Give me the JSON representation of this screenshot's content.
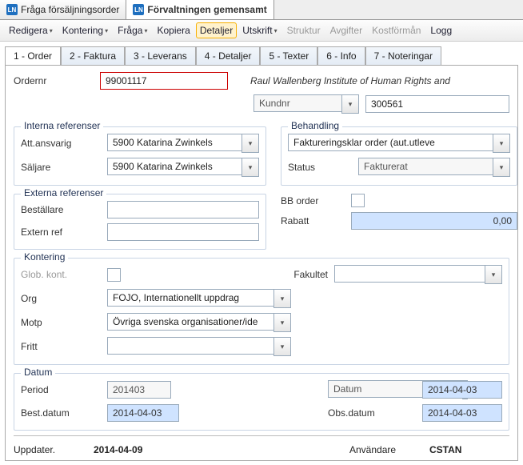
{
  "top_tabs": {
    "t1": "Fråga försäljningsorder",
    "t2": "Förvaltningen gemensamt",
    "ico": "LN"
  },
  "menu": {
    "redigera": "Redigera",
    "kontering": "Kontering",
    "fraga": "Fråga",
    "kopiera": "Kopiera",
    "detaljer": "Detaljer",
    "utskrift": "Utskrift",
    "struktur": "Struktur",
    "avgifter": "Avgifter",
    "kostforman": "Kostförmån",
    "logg": "Logg"
  },
  "sub_tabs": {
    "order": "1 - Order",
    "faktura": "2 - Faktura",
    "leverans": "3 - Leverans",
    "detaljer": "4 - Detaljer",
    "texter": "5 - Texter",
    "info": "6 - Info",
    "noteringar": "7 - Noteringar"
  },
  "order": {
    "ordernr_label": "Ordernr",
    "ordernr": "99001117",
    "customer_name": "Raul Wallenberg Institute of Human Rights and",
    "kundnr_label": "Kundnr",
    "kundnr": "300561"
  },
  "interna": {
    "legend": "Interna referenser",
    "att_label": "Att.ansvarig",
    "att_val": "5900 Katarina Zwinkels",
    "saljare_label": "Säljare",
    "saljare_val": "5900 Katarina Zwinkels"
  },
  "behandling": {
    "legend": "Behandling",
    "val": "Faktureringsklar order (aut.utleve",
    "status_label": "Status",
    "status_val": "Fakturerat",
    "bb_label": "BB order",
    "rabatt_label": "Rabatt",
    "rabatt_val": "0,00"
  },
  "externa": {
    "legend": "Externa referenser",
    "bestallare_label": "Beställare",
    "extern_label": "Extern ref"
  },
  "kontering": {
    "legend": "Kontering",
    "glob_label": "Glob. kont.",
    "fakultet_label": "Fakultet",
    "org_label": "Org",
    "org_val": "FOJO, Internationellt uppdrag",
    "motp_label": "Motp",
    "motp_val": "Övriga svenska organisationer/ide",
    "fritt_label": "Fritt"
  },
  "datum": {
    "legend": "Datum",
    "period_label": "Period",
    "period_val": "201403",
    "datum_label": "Datum",
    "datum_val": "2014-04-03",
    "best_label": "Best.datum",
    "best_val": "2014-04-03",
    "obs_label": "Obs.datum",
    "obs_val": "2014-04-03"
  },
  "footer": {
    "uppdater_label": "Uppdater.",
    "uppdater_val": "2014-04-09",
    "anvandare_label": "Användare",
    "anvandare_val": "CSTAN"
  }
}
